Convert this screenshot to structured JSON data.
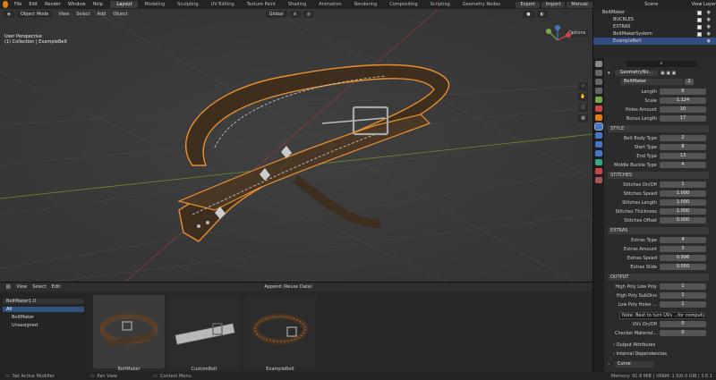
{
  "menu": [
    "File",
    "Edit",
    "Render",
    "Window",
    "Help"
  ],
  "workspaces": [
    "Layout",
    "Modeling",
    "Sculpting",
    "UV Editing",
    "Texture Paint",
    "Shading",
    "Animation",
    "Rendering",
    "Compositing",
    "Scripting",
    "Geometry Nodes"
  ],
  "top_buttons": [
    "Export",
    "Import",
    "Manual"
  ],
  "scene": "Scene",
  "view_layer": "View Layer",
  "viewport": {
    "mode": "Object Mode",
    "menus": [
      "View",
      "Select",
      "Add",
      "Object"
    ],
    "orientation": "Global",
    "options": "Options",
    "info_line1": "User Perspective",
    "info_line2": "(1) Collection | ExampleBelt"
  },
  "outliner": {
    "items": [
      "BeltMaker",
      "BUCKLES",
      "EXTRAS",
      "BeltMakerSystem",
      "ExampleBelt"
    ]
  },
  "properties": {
    "modifier_tab": "GeometryNo...",
    "modifier_name": "BeltMaker",
    "user_count": "2",
    "rows_top": [
      {
        "label": "Length",
        "value": "6"
      },
      {
        "label": "Scale",
        "value": "1.124"
      },
      {
        "label": "Holes Amount",
        "value": "10"
      },
      {
        "label": "Bonus Length",
        "value": "17"
      }
    ],
    "sections": [
      "STYLE",
      "STITCHES",
      "EXTRAS",
      "OUTPUT"
    ],
    "style_rows": [
      {
        "label": "Belt Body Type",
        "value": "2"
      },
      {
        "label": "Start Type",
        "value": "8"
      },
      {
        "label": "End Type",
        "value": "13"
      },
      {
        "label": "Middle Buckle Type",
        "value": "4"
      }
    ],
    "stitch_rows": [
      {
        "label": "Stitches On/Off",
        "value": "1"
      },
      {
        "label": "Stitches Speed",
        "value": "1.000"
      },
      {
        "label": "Stitches Length",
        "value": "1.000"
      },
      {
        "label": "Stitches Thickness",
        "value": "1.000"
      },
      {
        "label": "Stitches Offset",
        "value": "0.000"
      }
    ],
    "extra_rows": [
      {
        "label": "Extras Type",
        "value": "4"
      },
      {
        "label": "Extras Amount",
        "value": "3"
      },
      {
        "label": "Extras Speed",
        "value": "0.996"
      },
      {
        "label": "Extras Slide",
        "value": "0.050"
      }
    ],
    "output_rows": [
      {
        "label": "High Poly Low Poly",
        "value": "1"
      },
      {
        "label": "High Poly SubDivs",
        "value": "1"
      },
      {
        "label": "Low Poly Holes ...",
        "value": "1"
      },
      {
        "label": "UVs On/Off",
        "value": "0"
      },
      {
        "label": "Checker Material...",
        "value": "0"
      }
    ],
    "tooltip": "Note: Best to turn UVs ...for computation speed",
    "footer_items": [
      "Output Attributes",
      "Internal Dependencies"
    ],
    "curve_field": "Curve"
  },
  "asset_browser": {
    "menus": [
      "View",
      "Select",
      "Edit"
    ],
    "import_mode": "Append (Reuse Data)",
    "library": "BeltMaker1.0",
    "tree": [
      "All",
      "BeltMaker",
      "Unassigned"
    ],
    "thumbnails": [
      "BeltMaker",
      "CustomBelt",
      "ExampleBelt"
    ]
  },
  "status": {
    "left": "Set Active Modifier",
    "mid": "Pan View",
    "right_action": "Context Menu",
    "memory": "Memory: 91.8 MiB | VRAM: 1.5/6.0 GiB | 3.6.1"
  }
}
